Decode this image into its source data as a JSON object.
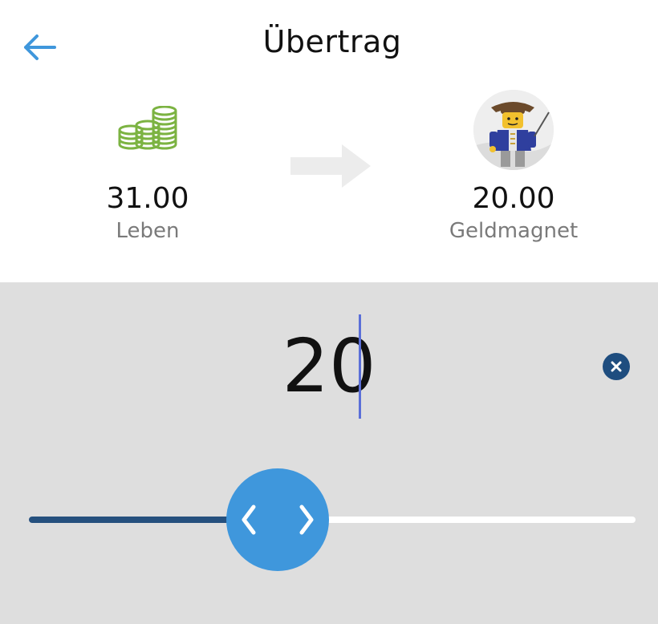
{
  "header": {
    "title": "Übertrag",
    "back_icon": "arrow-left-icon"
  },
  "from_account": {
    "amount": "31.00",
    "name": "Leben",
    "icon": "coins-icon"
  },
  "to_account": {
    "amount": "20.00",
    "name": "Geldmagnet",
    "icon": "avatar-image"
  },
  "transfer_icon": "arrow-right-icon",
  "amount_input": {
    "value": "20"
  },
  "clear_icon": "clear-icon",
  "slider": {
    "value_fraction": 0.41,
    "thumb_icon": "chevron-left-right-icon"
  },
  "colors": {
    "accent": "#3f97dc",
    "slider_fill": "#25507e",
    "coins": "#7cb342",
    "caret": "#5b6fd8",
    "clear_button": "#1e4d7f",
    "bottom_bg": "#dedede"
  }
}
